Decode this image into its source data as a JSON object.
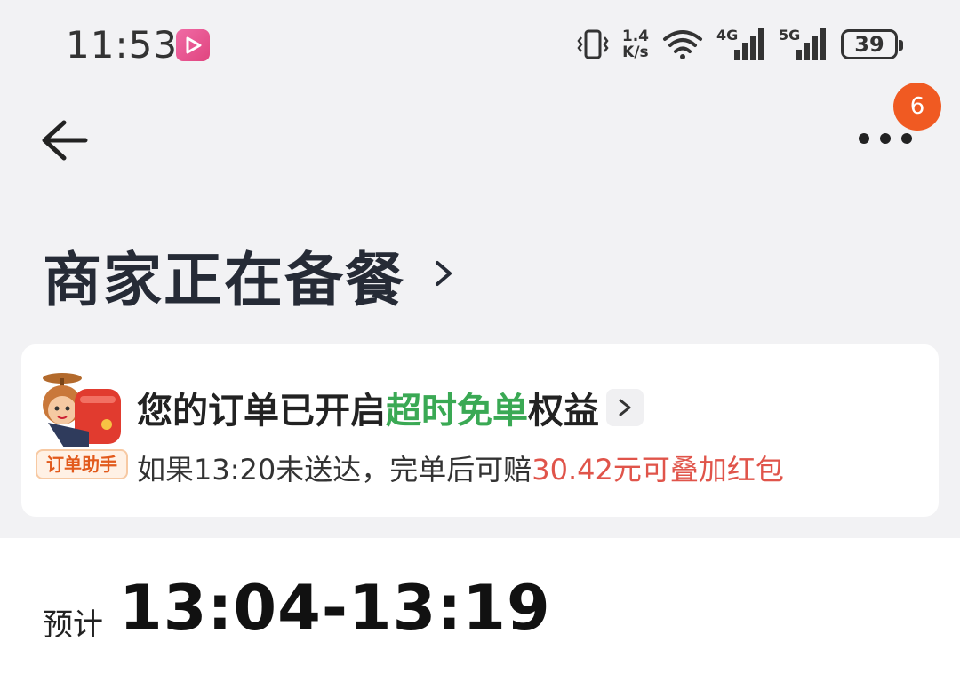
{
  "status_bar": {
    "time": "11:53",
    "net_speed_value": "1.4",
    "net_speed_unit": "K/s",
    "net1": "4G",
    "net2": "5G",
    "battery": "39"
  },
  "nav": {
    "badge_count": "6"
  },
  "order": {
    "status_title": "商家正在备餐"
  },
  "banner": {
    "assistant_tag": "订单助手",
    "line1_prefix": "您的订单已开启",
    "line1_highlight": "超时免单",
    "line1_suffix": "权益",
    "line2_prefix": "如果13:20未送达，完单后可赔",
    "line2_highlight": "30.42元可叠加红包"
  },
  "estimate": {
    "label": "预计",
    "time_range": "13:04-13:19"
  },
  "colors": {
    "accent_green": "#3aa954",
    "accent_red": "#e0544a",
    "badge_orange": "#f05a22"
  }
}
